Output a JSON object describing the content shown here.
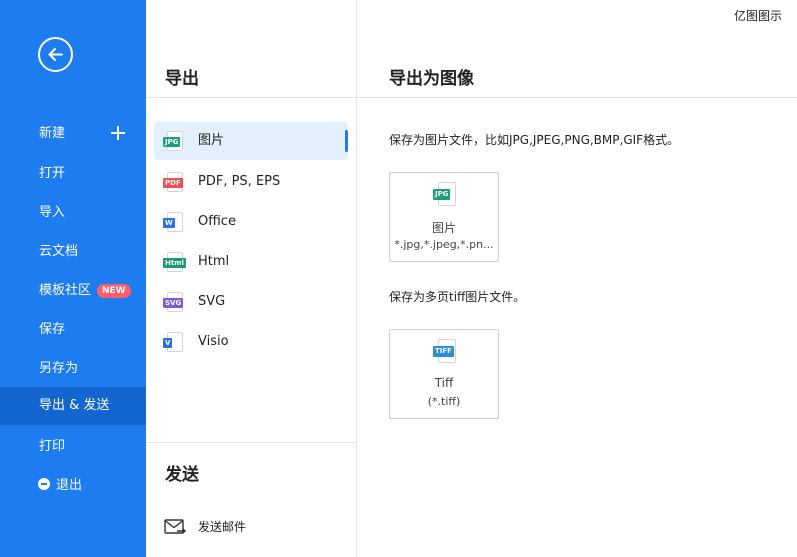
{
  "app": {
    "name": "亿图图示"
  },
  "sidebar": {
    "items": [
      {
        "label": "新建"
      },
      {
        "label": "打开"
      },
      {
        "label": "导入"
      },
      {
        "label": "云文档"
      },
      {
        "label": "模板社区",
        "badge": "NEW"
      },
      {
        "label": "保存"
      },
      {
        "label": "另存为"
      },
      {
        "label": "导出 & 发送"
      },
      {
        "label": "打印"
      },
      {
        "label": "退出"
      }
    ],
    "active_index": 7,
    "colors": {
      "background": "#1c7cf0",
      "active": "#1366cf",
      "badge": "#ff5d6b"
    }
  },
  "export_panel": {
    "title": "导出",
    "formats": [
      {
        "label": "图片",
        "tag": "JPG",
        "tag_color": "#1aa17c",
        "icon": "jpg-file-icon"
      },
      {
        "label": "PDF, PS, EPS",
        "tag": "PDF",
        "tag_color": "#ef4f4f",
        "icon": "pdf-file-icon"
      },
      {
        "label": "Office",
        "tag": "W",
        "tag_color": "#2b73e6",
        "icon": "word-file-icon"
      },
      {
        "label": "Html",
        "tag": "Html",
        "tag_color": "#1c9c6c",
        "icon": "html-file-icon"
      },
      {
        "label": "SVG",
        "tag": "SVG",
        "tag_color": "#7d5bd4",
        "icon": "svg-file-icon"
      },
      {
        "label": "Visio",
        "tag": "V",
        "tag_color": "#2b6fd8",
        "icon": "visio-file-icon"
      }
    ],
    "selected_index": 0
  },
  "send_panel": {
    "title": "发送",
    "items": [
      {
        "label": "发送邮件",
        "icon": "mail-send-icon"
      }
    ]
  },
  "detail": {
    "title": "导出为图像",
    "sections": [
      {
        "description": "保存为图片文件，比如JPG,JPEG,PNG,BMP,GIF格式。",
        "card": {
          "tag": "JPG",
          "tag_color": "#1aa17c",
          "title": "图片",
          "subtitle": "*.jpg,*.jpeg,*.pn..."
        }
      },
      {
        "description": "保存为多页tiff图片文件。",
        "card": {
          "tag": "TIFF",
          "tag_color": "#2b8fd6",
          "title": "Tiff",
          "subtitle": "(*.tiff)"
        }
      }
    ]
  }
}
